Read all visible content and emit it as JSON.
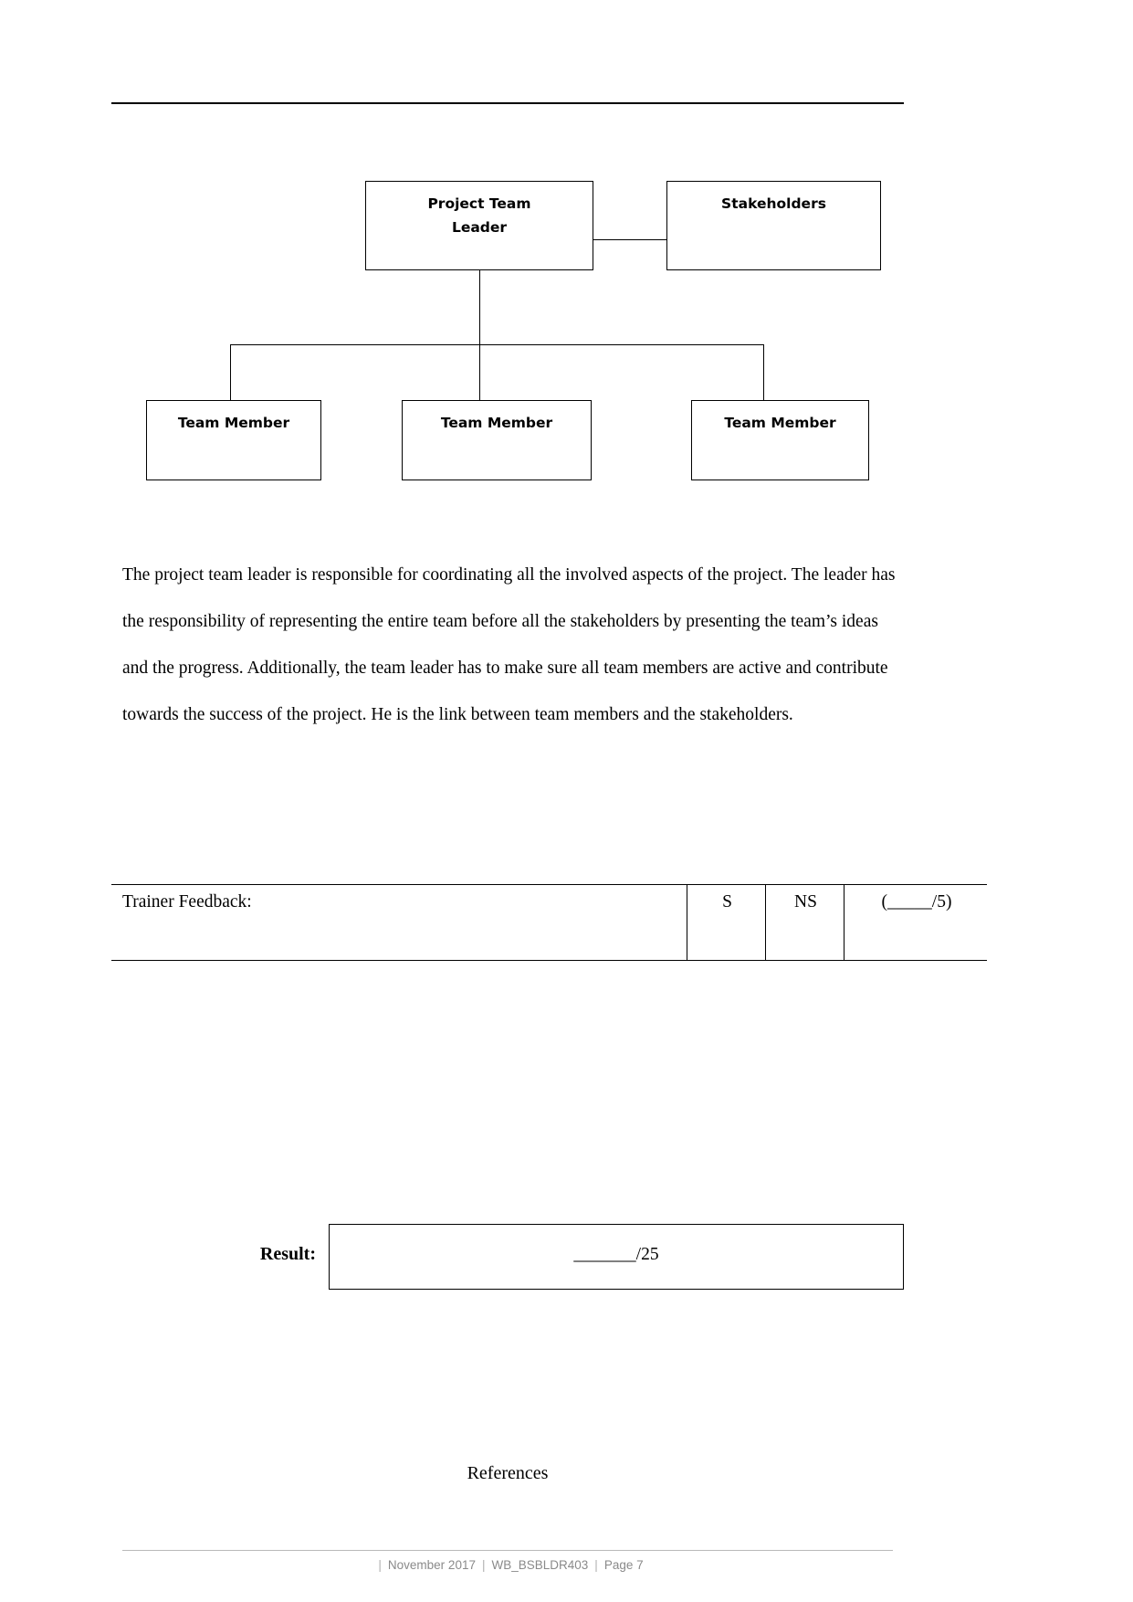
{
  "document": {
    "header_rule": true,
    "page_label": "Page 7"
  },
  "org_chart": {
    "nodes": {
      "leader": "Project Team\nLeader",
      "leader_line1": "Project Team",
      "leader_line2": "Leader",
      "stakeholders": "Stakeholders",
      "member_1": "Team Member",
      "member_2": "Team Member",
      "member_3": "Team Member"
    }
  },
  "body": {
    "paragraph": "The project team leader is responsible for coordinating all the involved aspects of the project. The leader has the responsibility of representing the entire team before all the stakeholders by presenting the team’s ideas and the progress. Additionally, the team leader has to make sure all team members are active and contribute towards the success of the project. He is the link between team members and the stakeholders."
  },
  "feedback_table": {
    "label": "Trainer Feedback:",
    "satisfactory": "S",
    "not_satisfactory": "NS",
    "score": "(_____/5)"
  },
  "result": {
    "label": "Result:",
    "value": "_______/25"
  },
  "references": {
    "heading": "References"
  },
  "footer": {
    "date": "November 2017",
    "code": "WB_BSBLDR403",
    "page": "Page 7",
    "separator": "|"
  }
}
